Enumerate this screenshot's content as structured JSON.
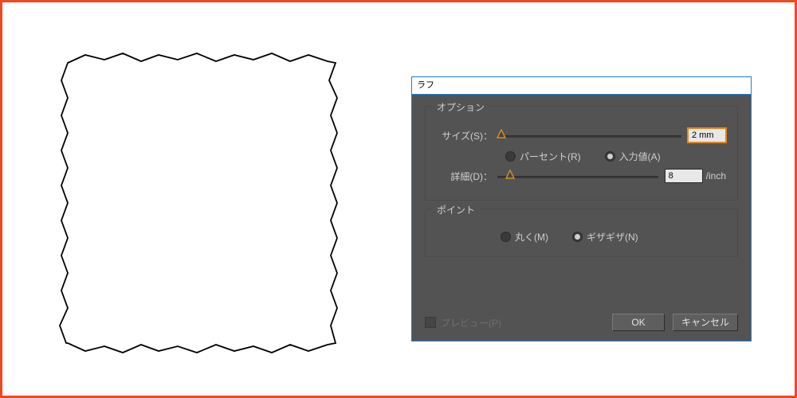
{
  "dialog": {
    "title": "ラフ",
    "options_title": "オプション",
    "size_label": "サイズ(S)：",
    "size_value": "2 mm",
    "mode_percent": "パーセント(R)",
    "mode_absolute": "入力値(A)",
    "mode_selected": "absolute",
    "detail_label": "詳細(D)：",
    "detail_value": "8",
    "detail_unit": "/inch",
    "points_title": "ポイント",
    "point_smooth": "丸く(M)",
    "point_corner": "ギザギザ(N)",
    "point_selected": "corner",
    "preview_label": "プレビュー(P)",
    "ok_label": "OK",
    "cancel_label": "キャンセル"
  },
  "slider": {
    "size_pos_pct": 2,
    "detail_pos_pct": 8
  }
}
